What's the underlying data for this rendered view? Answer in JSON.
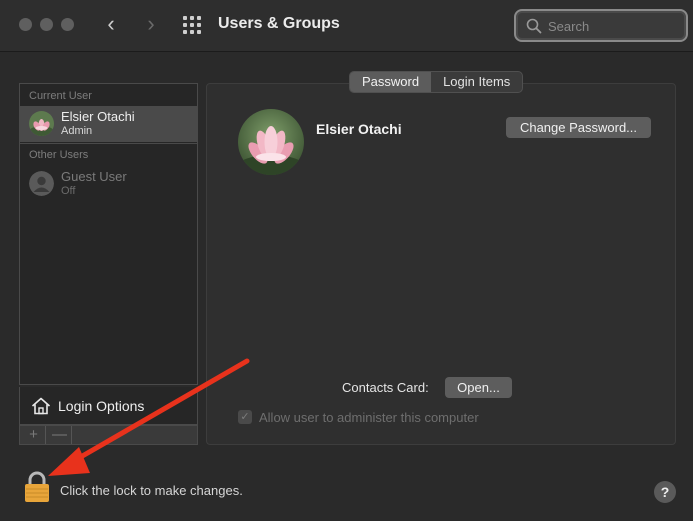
{
  "window": {
    "title": "Users & Groups"
  },
  "toolbar": {
    "back_icon": "chevron-left-icon",
    "forward_icon": "chevron-right-icon",
    "show_all_icon": "grid-icon",
    "search_placeholder": "Search"
  },
  "sidebar": {
    "current_user_label": "Current User",
    "other_users_label": "Other Users",
    "users": [
      {
        "name": "Elsier Otachi",
        "role": "Admin",
        "selected": true
      },
      {
        "name": "Guest User",
        "role": "Off",
        "selected": false
      }
    ],
    "login_options_label": "Login Options",
    "add_label": "+",
    "remove_label": "—"
  },
  "main": {
    "tabs": [
      {
        "label": "Password",
        "active": true
      },
      {
        "label": "Login Items",
        "active": false
      }
    ],
    "user_name": "Elsier Otachi",
    "change_password_label": "Change Password...",
    "contacts_card_label": "Contacts Card:",
    "open_label": "Open...",
    "allow_admin_label": "Allow user to administer this computer",
    "allow_admin_checked": true
  },
  "footer": {
    "lock_text": "Click the lock to make changes.",
    "help_label": "?"
  },
  "colors": {
    "annotation_arrow": "#e8321c",
    "lock_body": "#e8a53a"
  }
}
